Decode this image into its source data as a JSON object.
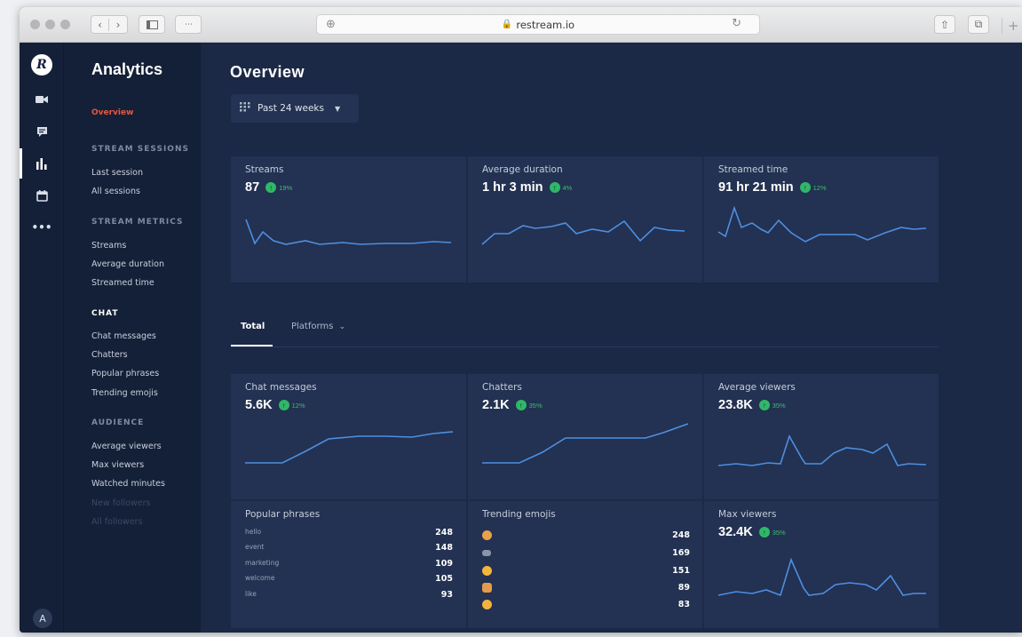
{
  "browser": {
    "url": "restream.io"
  },
  "rail": {
    "logo": "R",
    "icons": [
      "video-icon",
      "chat-icon",
      "analytics-icon",
      "calendar-icon",
      "more-icon"
    ],
    "avatar": "A"
  },
  "sidebar": {
    "title": "Analytics",
    "overview": "Overview",
    "sections": [
      {
        "heading": "STREAM SESSIONS",
        "items": [
          "Last session",
          "All sessions"
        ]
      },
      {
        "heading": "STREAM METRICS",
        "items": [
          "Streams",
          "Average duration",
          "Streamed time"
        ]
      },
      {
        "heading": "CHAT",
        "items": [
          "Chat messages",
          "Chatters",
          "Popular phrases",
          "Trending emojis"
        ]
      },
      {
        "heading": "AUDIENCE",
        "items": [
          "Average viewers",
          "Max viewers",
          "Watched minutes",
          "New followers",
          "All followers"
        ]
      }
    ]
  },
  "main": {
    "title": "Overview",
    "range": "Past 24 weeks",
    "top_cards": [
      {
        "label": "Streams",
        "value": "87",
        "change": "19%"
      },
      {
        "label": "Average duration",
        "value": "1 hr 3 min",
        "change": "4%"
      },
      {
        "label": "Streamed time",
        "value": "91 hr 21 min",
        "change": "12%"
      }
    ],
    "tabs": [
      "Total",
      "Platforms"
    ],
    "mid_cards": [
      {
        "label": "Chat messages",
        "value": "5.6K",
        "change": "12%"
      },
      {
        "label": "Chatters",
        "value": "2.1K",
        "change": "35%"
      },
      {
        "label": "Average viewers",
        "value": "23.8K",
        "change": "35%"
      }
    ],
    "popular_phrases": {
      "label": "Popular phrases",
      "rows": [
        {
          "phrase": "hello",
          "count": "248"
        },
        {
          "phrase": "event",
          "count": "148"
        },
        {
          "phrase": "marketing",
          "count": "109"
        },
        {
          "phrase": "welcome",
          "count": "105"
        },
        {
          "phrase": "like",
          "count": "93"
        }
      ]
    },
    "trending_emojis": {
      "label": "Trending emojis",
      "rows": [
        {
          "emoji": "emoji-1",
          "count": "248"
        },
        {
          "emoji": "emoji-2",
          "count": "169"
        },
        {
          "emoji": "emoji-3",
          "count": "151"
        },
        {
          "emoji": "emoji-4",
          "count": "89"
        },
        {
          "emoji": "emoji-5",
          "count": "83"
        }
      ]
    },
    "max_viewers": {
      "label": "Max viewers",
      "value": "32.4K",
      "change": "35%"
    }
  },
  "colors": {
    "background": "#1b2846",
    "sidebar": "#142038",
    "card": "#233152",
    "accent": "#e8573f",
    "line": "#4d8fe0",
    "positive": "#2fb866"
  }
}
